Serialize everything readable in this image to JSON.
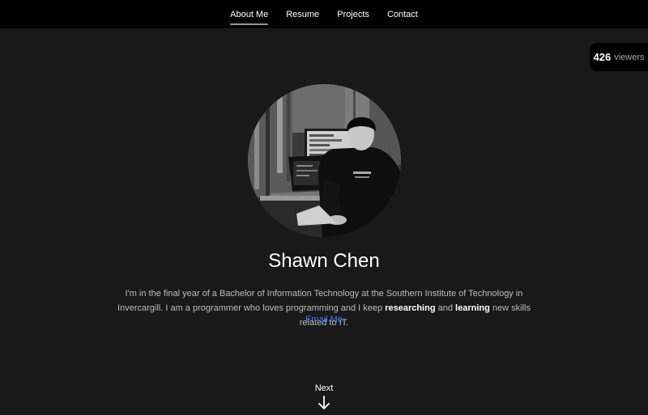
{
  "nav": {
    "items": [
      {
        "label": "About Me",
        "active": true
      },
      {
        "label": "Resume",
        "active": false
      },
      {
        "label": "Projects",
        "active": false
      },
      {
        "label": "Contact",
        "active": false
      }
    ]
  },
  "viewers": {
    "count": "426",
    "label": "viewers"
  },
  "profile": {
    "name": "Shawn Chen",
    "bio_part1": "I'm in the final year of a Bachelor of Information Technology at the Southern Institute of Technology in Invercargill. I am a programmer who loves programming and I keep ",
    "bio_bold1": "researching",
    "bio_part2": " and ",
    "bio_bold2": "learning",
    "bio_part3": " new skills related to IT.",
    "email_label": "Email Me"
  },
  "next": {
    "label": "Next"
  },
  "colors": {
    "background": "#19191a",
    "nav_background": "#000000",
    "link": "#3d7be8"
  }
}
